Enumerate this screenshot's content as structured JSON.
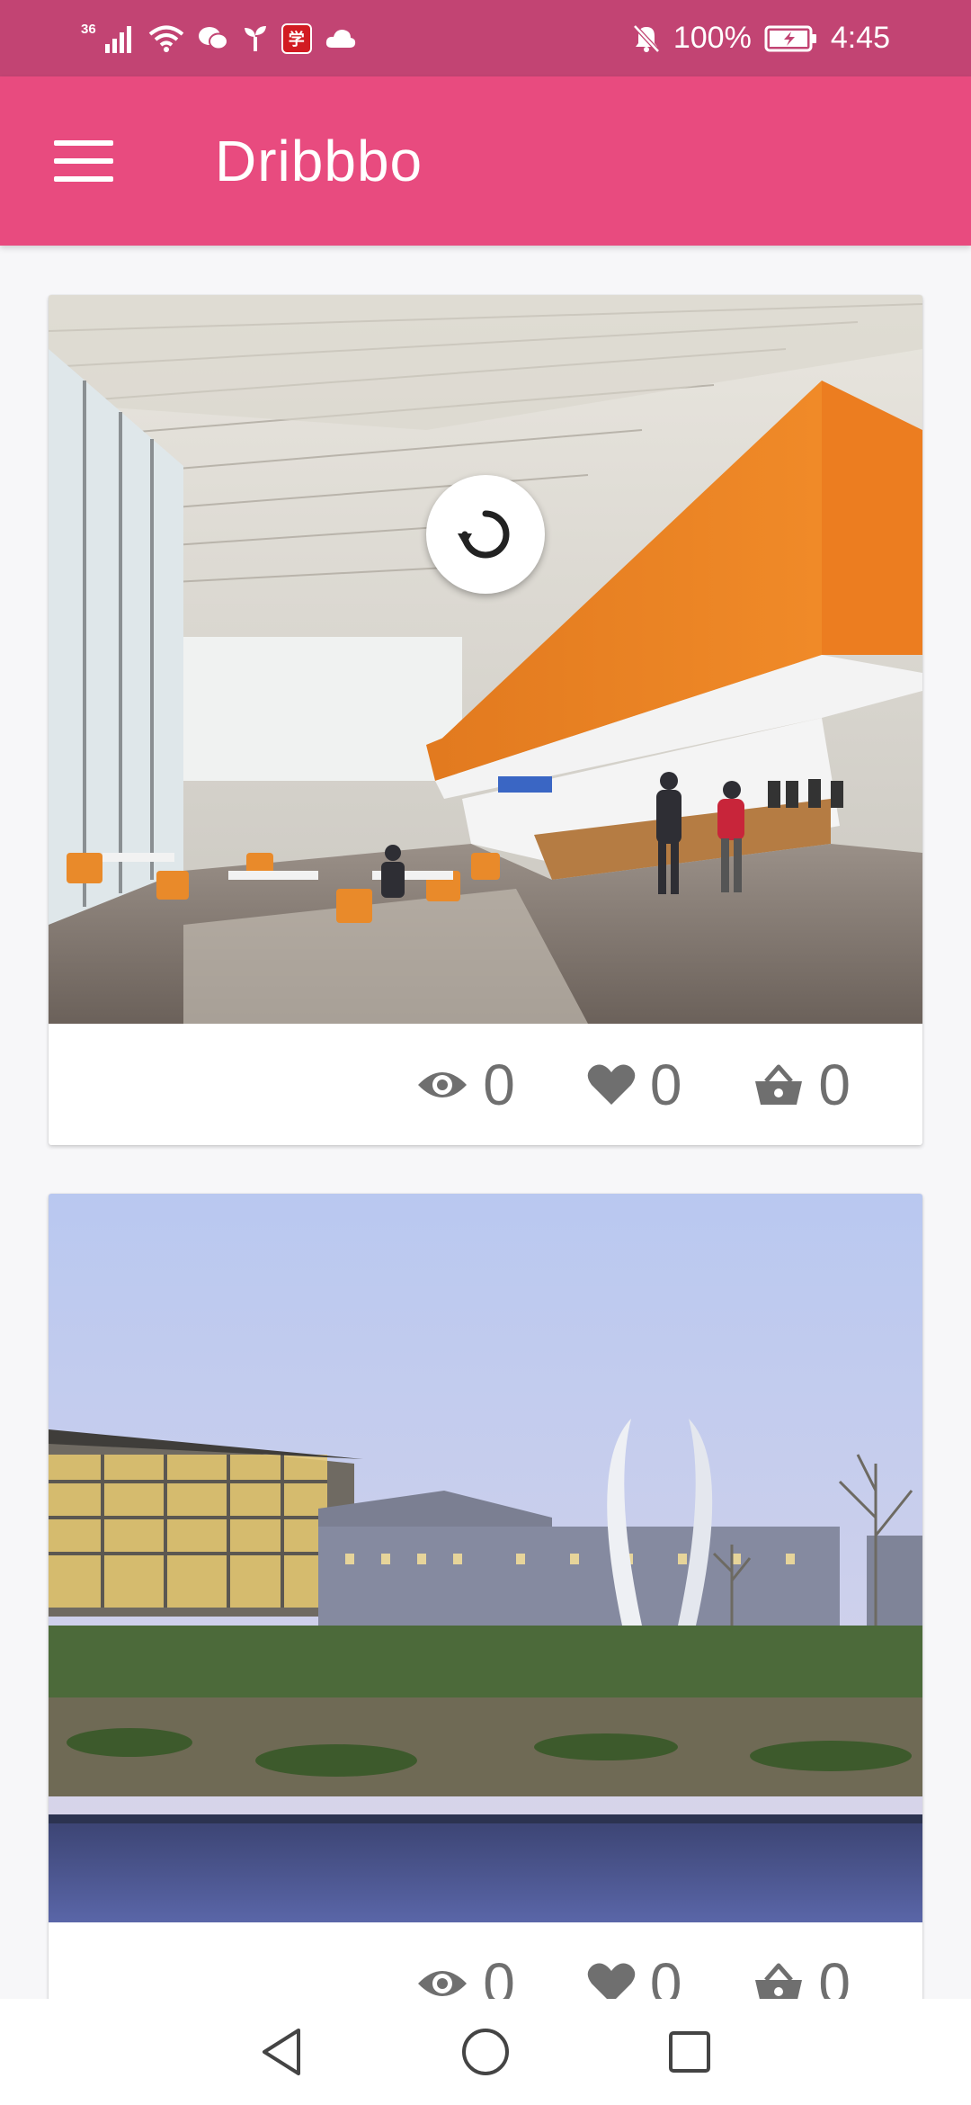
{
  "status_bar": {
    "network": "36",
    "battery": "100%",
    "time": "4:45",
    "badge_text": "学"
  },
  "app_bar": {
    "title": "Dribbbo"
  },
  "cards": [
    {
      "image_subject": "campus dining hall interior",
      "views": "0",
      "likes": "0",
      "buckets": "0"
    },
    {
      "image_subject": "campus buildings and arch sculpture at dusk",
      "views": "0",
      "likes": "0",
      "buckets": "0"
    }
  ],
  "colors": {
    "status_bar": "#c24473",
    "app_bar": "#e84b7f",
    "background": "#f7f7f9",
    "stat_icon": "#6f6f6f"
  },
  "icons": {
    "menu": "hamburger-icon",
    "refresh": "refresh-icon",
    "views": "eye-icon",
    "likes": "heart-icon",
    "buckets": "basket-icon",
    "back": "triangle-back-icon",
    "home": "circle-home-icon",
    "recents": "square-recents-icon"
  }
}
